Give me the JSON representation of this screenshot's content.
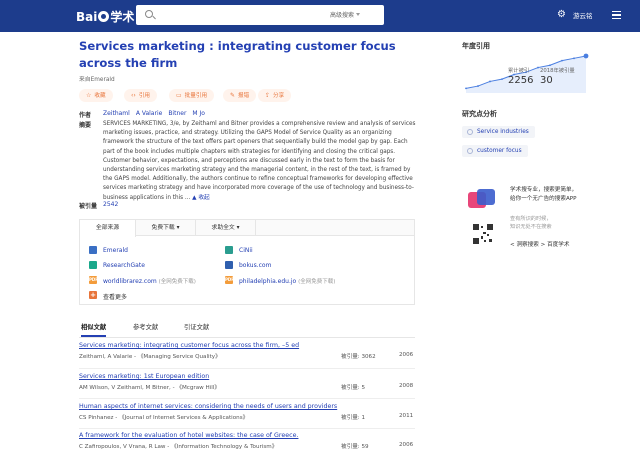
{
  "header": {
    "logo_left": "Bai",
    "logo_right": "学术",
    "search_placeholder": "",
    "advanced_search": "高级搜索",
    "user_name": "游云铭"
  },
  "paper": {
    "title": "Services marketing : integrating customer focus across the firm",
    "source": "来自Emerald",
    "actions": [
      {
        "icon": "star-icon",
        "label": "收藏"
      },
      {
        "icon": "quote-icon",
        "label": "引用"
      },
      {
        "icon": "batch-cite-icon",
        "label": "批量引用"
      },
      {
        "icon": "report-icon",
        "label": "报错"
      },
      {
        "icon": "share-icon",
        "label": "分享"
      }
    ],
    "authors_label": "作者",
    "authors": [
      "Zeithaml",
      "A Valarie",
      "Bitner",
      "M Jo"
    ],
    "abstract_label": "摘要",
    "abstract": "SERVICES MARKETING, 3/e, by Zeithaml and Bitner provides a comprehensive review and analysis of services marketing issues, practice, and strategy. Utilizing the GAPS Model of Service Quality as an organizing framework the structure of the text offers part openers that sequentially build the model gap by gap. Each part of the book includes multiple chapters with strategies for identifying and closing the critical gaps. Customer behavior, expectations, and perceptions are discussed early in the text to form the basis for understanding services marketing strategy and the managerial content, in the rest of the text, is framed by the GAPS model. Additionally, the authors continue to refine conceptual frameworks for developing effective services marketing strategy and have incorporated more coverage of the use of technology and business-to-business applications in this",
    "abstract_collapse": "收起",
    "cited_label": "被引量",
    "cited_count": "2542"
  },
  "sources": {
    "tabs": [
      "全部来源",
      "免费下载",
      "求助全文"
    ],
    "items": [
      {
        "name": "Emerald",
        "free": "",
        "icon_color": "#3a6fc4",
        "icon_text": ""
      },
      {
        "name": "CiNii",
        "free": "",
        "icon_color": "#2a9d8f",
        "icon_text": ""
      },
      {
        "name": "ResearchGate",
        "free": "",
        "icon_color": "#1aa88b",
        "icon_text": ""
      },
      {
        "name": "bokus.com",
        "free": "",
        "icon_color": "#2f5fae",
        "icon_text": ""
      },
      {
        "name": "worldlibrarez.com",
        "free": "(全网免费下载)",
        "icon_color": "#f39c3b",
        "icon_text": "PDF"
      },
      {
        "name": "philadelphia.edu.jo",
        "free": "(全网免费下载)",
        "icon_color": "#f39c3b",
        "icon_text": "PDF"
      }
    ],
    "more": "查看更多"
  },
  "related": {
    "tabs": [
      "相似文献",
      "参考文献",
      "引证文献"
    ],
    "items": [
      {
        "title": "Services marketing: integrating customer focus across the firm, –5 ed",
        "meta": "Zeithaml,  A Valarie - 《Managing Service Quality》",
        "cited": "被引量: 3062",
        "year": "2006"
      },
      {
        "title": "Services marketing: 1st European edition",
        "meta": "AM Wilson,  V Zeithaml,  M Bitner,  - 《Mcgraw Hill》",
        "cited": "被引量: 5",
        "year": "2008"
      },
      {
        "title": "Human aspects of internet services: considering the needs of users and providers",
        "meta": "CS Pinhanez - 《Journal of Internet Services & Applications》",
        "cited": "被引量: 1",
        "year": "2011"
      },
      {
        "title": "A framework for the evaluation of hotel websites: the case of Greece.",
        "meta": "C Zafiropoulos,  V Vrana,  R Law - 《Information Technology & Tourism》",
        "cited": "被引量: 59",
        "year": "2006"
      }
    ]
  },
  "sidebar": {
    "yearly_title": "年度引用",
    "total_label": "累计被引",
    "total_value": "2256",
    "year_label": "2018年被引量",
    "year_value": "30",
    "research_title": "研究点分析",
    "research_points": [
      "Service industries",
      "customer focus"
    ],
    "ad": {
      "line1": "学术搜专业，搜索更简单，",
      "line2": "给你一个无广告的搜索APP",
      "sub1": "查有所识的时候，",
      "sub2": "知识无处不在搜索",
      "link": "< 洞察搜索 > 百度学术"
    }
  },
  "colors": {
    "header_bg": "#1d3c8c",
    "link": "#2440b3",
    "action": "#e8743a"
  },
  "chart_data": {
    "type": "area",
    "values": [
      2,
      3,
      5,
      6,
      8,
      9,
      11,
      12,
      14,
      15,
      16
    ]
  }
}
